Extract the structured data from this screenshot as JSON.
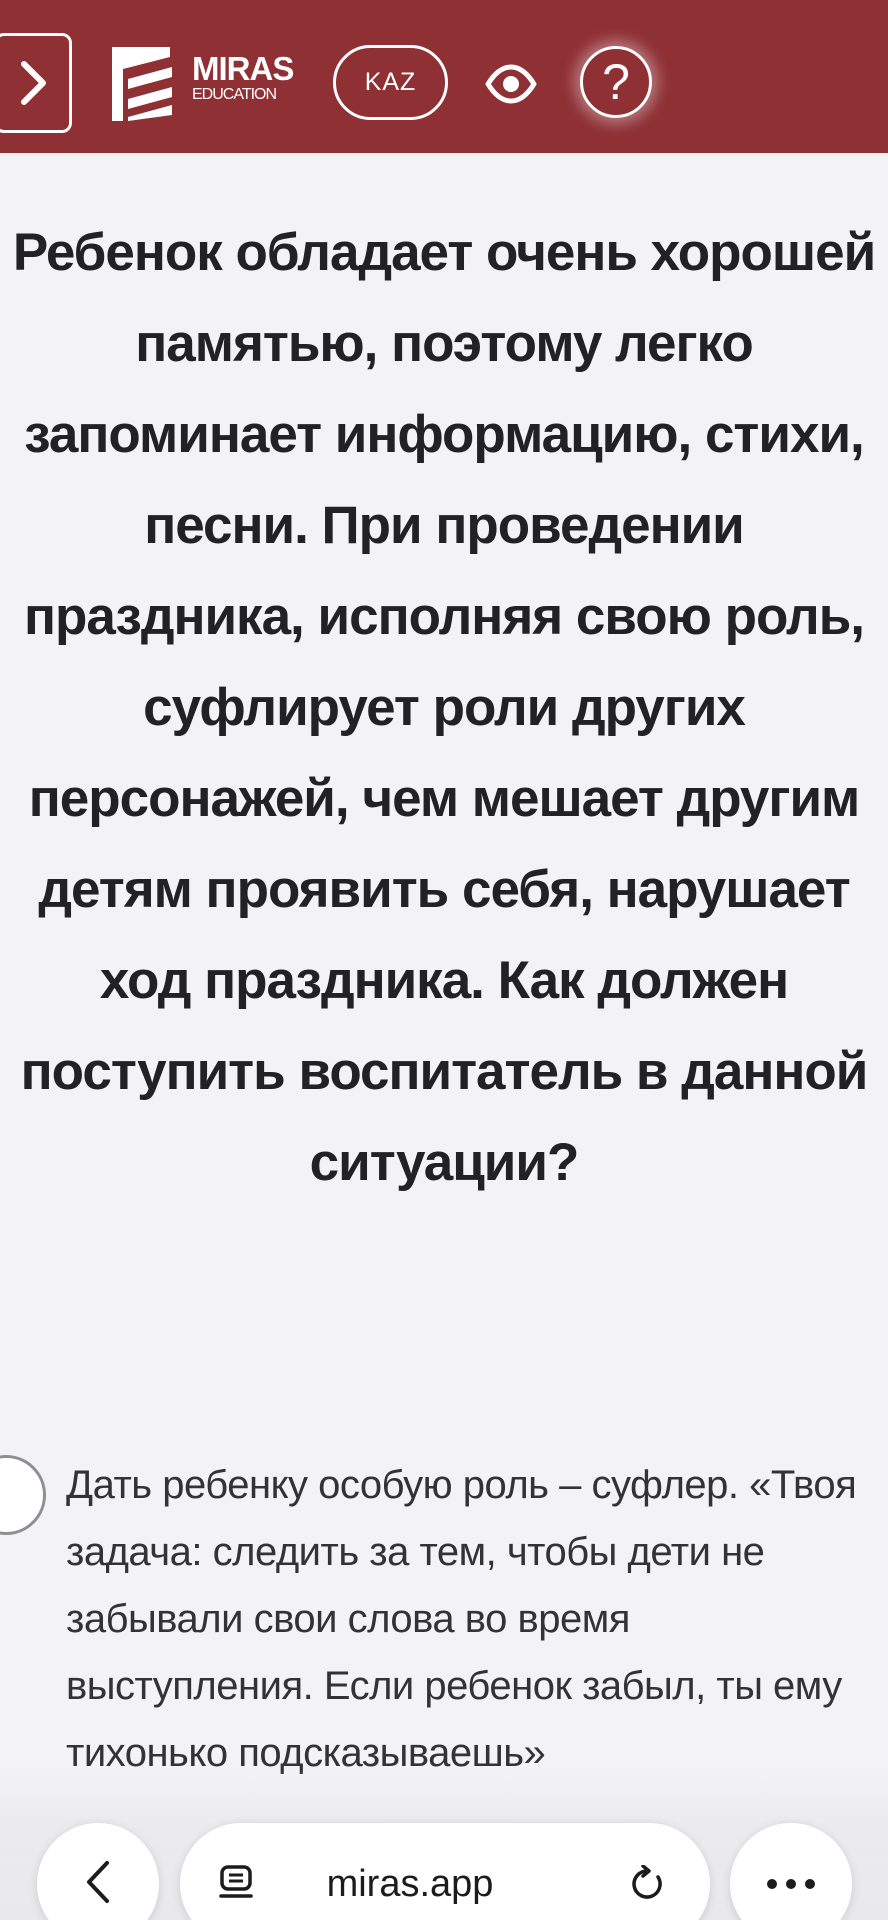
{
  "header": {
    "logo": {
      "name": "MIRAS",
      "subtitle": "EDUCATION"
    },
    "language_button": "KAZ",
    "icons": {
      "menu_toggle": "chevron-right-icon",
      "accessibility": "eye-icon",
      "help": "question-icon"
    },
    "help_label": "?",
    "colors": {
      "background": "#8f3035",
      "foreground": "#ffffff"
    }
  },
  "question": {
    "text": "Ребенок обладает очень хорошей памятью, поэтому легко запоминает информацию, стихи, песни. При проведении праздника, исполняя свою роль, суфлирует роли других персонажей, чем мешает другим детям проявить себя, нарушает ход праздника. Как должен поступить воспитатель в данной ситуации?"
  },
  "answers": [
    {
      "text": "Дать ребенку особую роль – суфлер. «Твоя задача: следить за тем, чтобы дети не забывали свои слова во время выступления. Если ребенок забыл, ты ему тихонько подсказываешь»",
      "selected": false
    }
  ],
  "browser_bar": {
    "url": "miras.app",
    "icons": {
      "back": "chevron-left-icon",
      "reader": "reader-mode-icon",
      "reload": "reload-icon",
      "more": "more-icon"
    }
  }
}
